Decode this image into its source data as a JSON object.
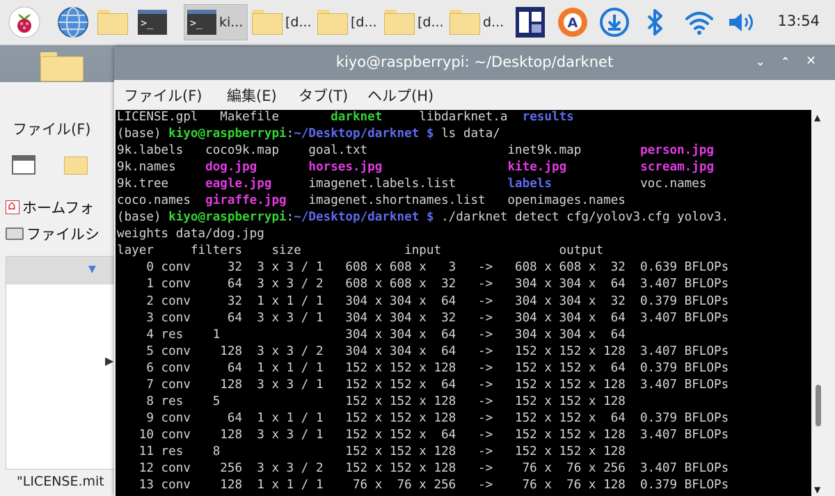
{
  "taskbar": {
    "buttons": [
      {
        "label": "ki..."
      },
      {
        "label": "[d..."
      },
      {
        "label": "[d..."
      },
      {
        "label": "[d..."
      },
      {
        "label": "d..."
      }
    ],
    "clock": "13:54"
  },
  "file_manager": {
    "menu_file": "ファイル(F)",
    "sidebar_home": "ホームフォ",
    "sidebar_filesystem": "ファイルシ",
    "status": "\"LICENSE.mit"
  },
  "terminal": {
    "title": "kiyo@raspberrypi: ~/Desktop/darknet",
    "menu": [
      "ファイル(F)",
      "編集(E)",
      "タブ(T)",
      "ヘルプ(H)"
    ],
    "lines": [
      [
        {
          "t": "LICENSE.gpl   Makefile       "
        },
        {
          "t": "darknet",
          "c": "g"
        },
        {
          "t": "     libdarknet.a  "
        },
        {
          "t": "results",
          "c": "b"
        }
      ],
      [
        {
          "t": "(base) "
        },
        {
          "t": "kiyo@raspberrypi",
          "c": "g"
        },
        {
          "t": ":"
        },
        {
          "t": "~/Desktop/darknet $",
          "c": "b"
        },
        {
          "t": " ls data/"
        }
      ],
      [
        {
          "t": "9k.labels   coco9k.map    goal.txt                   inet9k.map        "
        },
        {
          "t": "person.jpg",
          "c": "m"
        }
      ],
      [
        {
          "t": "9k.names    "
        },
        {
          "t": "dog.jpg",
          "c": "m"
        },
        {
          "t": "       "
        },
        {
          "t": "horses.jpg",
          "c": "m"
        },
        {
          "t": "                 "
        },
        {
          "t": "kite.jpg",
          "c": "m"
        },
        {
          "t": "          "
        },
        {
          "t": "scream.jpg",
          "c": "m"
        }
      ],
      [
        {
          "t": "9k.tree     "
        },
        {
          "t": "eagle.jpg",
          "c": "m"
        },
        {
          "t": "     imagenet.labels.list       "
        },
        {
          "t": "labels",
          "c": "b"
        },
        {
          "t": "            voc.names"
        }
      ],
      [
        {
          "t": "coco.names  "
        },
        {
          "t": "giraffe.jpg",
          "c": "m"
        },
        {
          "t": "   imagenet.shortnames.list   openimages.names"
        }
      ],
      [
        {
          "t": "(base) "
        },
        {
          "t": "kiyo@raspberrypi",
          "c": "g"
        },
        {
          "t": ":"
        },
        {
          "t": "~/Desktop/darknet $",
          "c": "b"
        },
        {
          "t": " ./darknet detect cfg/yolov3.cfg yolov3."
        }
      ],
      [
        {
          "t": "weights data/dog.jpg"
        }
      ],
      [
        {
          "t": "layer     filters    size              input                output"
        }
      ],
      [
        {
          "t": "    0 conv     32  3 x 3 / 1   608 x 608 x   3   ->   608 x 608 x  32  0.639 BFLOPs"
        }
      ],
      [
        {
          "t": "    1 conv     64  3 x 3 / 2   608 x 608 x  32   ->   304 x 304 x  64  3.407 BFLOPs"
        }
      ],
      [
        {
          "t": "    2 conv     32  1 x 1 / 1   304 x 304 x  64   ->   304 x 304 x  32  0.379 BFLOPs"
        }
      ],
      [
        {
          "t": "    3 conv     64  3 x 3 / 1   304 x 304 x  32   ->   304 x 304 x  64  3.407 BFLOPs"
        }
      ],
      [
        {
          "t": "    4 res    1                 304 x 304 x  64   ->   304 x 304 x  64"
        }
      ],
      [
        {
          "t": "    5 conv    128  3 x 3 / 2   304 x 304 x  64   ->   152 x 152 x 128  3.407 BFLOPs"
        }
      ],
      [
        {
          "t": "    6 conv     64  1 x 1 / 1   152 x 152 x 128   ->   152 x 152 x  64  0.379 BFLOPs"
        }
      ],
      [
        {
          "t": "    7 conv    128  3 x 3 / 1   152 x 152 x  64   ->   152 x 152 x 128  3.407 BFLOPs"
        }
      ],
      [
        {
          "t": "    8 res    5                 152 x 152 x 128   ->   152 x 152 x 128"
        }
      ],
      [
        {
          "t": "    9 conv     64  1 x 1 / 1   152 x 152 x 128   ->   152 x 152 x  64  0.379 BFLOPs"
        }
      ],
      [
        {
          "t": "   10 conv    128  3 x 3 / 1   152 x 152 x  64   ->   152 x 152 x 128  3.407 BFLOPs"
        }
      ],
      [
        {
          "t": "   11 res    8                 152 x 152 x 128   ->   152 x 152 x 128"
        }
      ],
      [
        {
          "t": "   12 conv    256  3 x 3 / 2   152 x 152 x 128   ->    76 x  76 x 256  3.407 BFLOPs"
        }
      ],
      [
        {
          "t": "   13 conv    128  1 x 1 / 1    76 x  76 x 256   ->    76 x  76 x 128  0.379 BFLOPs"
        }
      ]
    ]
  }
}
